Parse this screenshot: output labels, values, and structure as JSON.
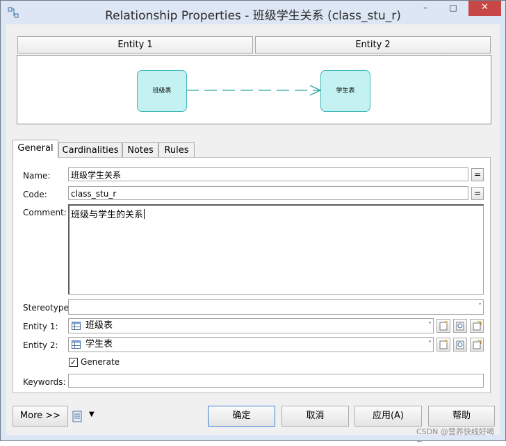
{
  "window": {
    "title": "Relationship Properties - 班级学生关系 (class_stu_r)",
    "minimize_glyph": "–",
    "maximize_glyph": "□",
    "close_glyph": "✕"
  },
  "entity_headers": {
    "entity1": "Entity 1",
    "entity2": "Entity 2"
  },
  "diagram": {
    "entity1_label": "班级表",
    "entity2_label": "学生表",
    "fill_color": "#c4f1f1",
    "line_color": "#2aa5a5"
  },
  "tabs": [
    {
      "label": "General",
      "active": true
    },
    {
      "label": "Cardinalities",
      "active": false
    },
    {
      "label": "Notes",
      "active": false
    },
    {
      "label": "Rules",
      "active": false
    }
  ],
  "general": {
    "name_label": "Name:",
    "name_value": "班级学生关系",
    "code_label": "Code:",
    "code_value": "class_stu_r",
    "eq_button": "=",
    "comment_label": "Comment:",
    "comment_value": "班级与学生的关系",
    "stereotype_label": "Stereotype:",
    "stereotype_value": "",
    "entity1_label": "Entity 1:",
    "entity1_value": "班级表",
    "entity2_label": "Entity 2:",
    "entity2_value": "学生表",
    "generate_label": "Generate",
    "generate_checked": true,
    "keywords_label": "Keywords:",
    "keywords_value": ""
  },
  "bottom": {
    "more_label": "More >>",
    "ok_label": "确定",
    "cancel_label": "取消",
    "apply_label": "应用(A)",
    "help_label": "帮助"
  },
  "watermark": "CSDN @营养快线好喝~"
}
